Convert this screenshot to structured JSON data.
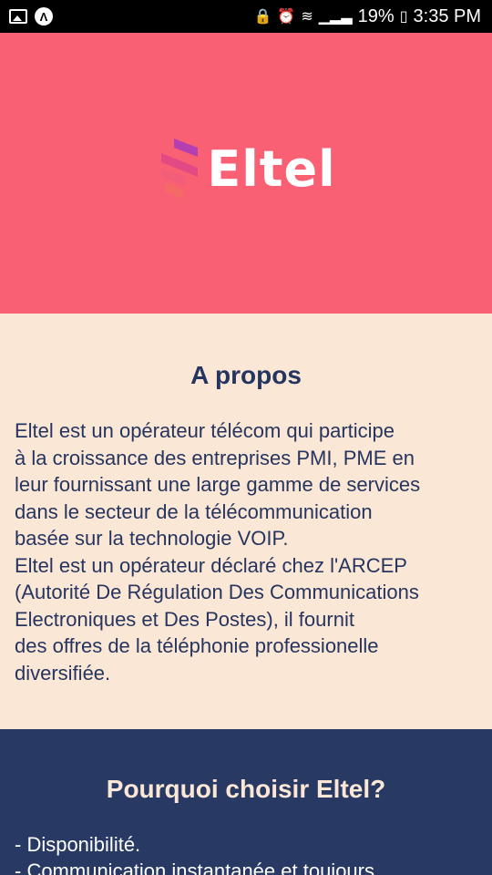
{
  "status_bar": {
    "battery": "19%",
    "time": "3:35 PM"
  },
  "header": {
    "brand": "Eltel",
    "colors": {
      "background": "#fa6073",
      "logo_mark": "#c2185b"
    }
  },
  "about": {
    "title": "A propos",
    "text": "Eltel est un opérateur télécom qui participe\nà la croissance des entreprises PMI, PME en\nleur fournissant une large gamme de services\ndans le secteur de la télécommunication\nbasée sur la technologie VOIP.\nEltel est un opérateur déclaré chez l'ARCEP\n(Autorité De Régulation Des Communications\nElectroniques et Des Postes), il fournit\ndes offres de la téléphonie professionelle\ndiversifiée."
  },
  "why": {
    "title": "Pourquoi choisir Eltel?",
    "items": [
      "- Disponibilité.",
      "- Communication instantanée et toujours"
    ]
  }
}
